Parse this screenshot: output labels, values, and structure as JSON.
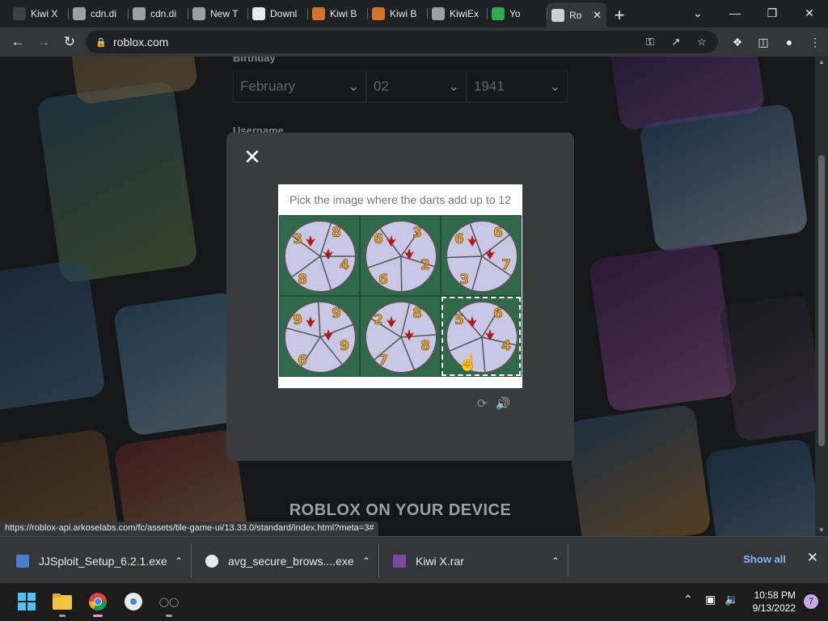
{
  "tabs": [
    {
      "label": "Kiwi X",
      "favicon": "kiwi-icon",
      "color": "#3c4043"
    },
    {
      "label": "cdn.di",
      "favicon": "globe-icon",
      "color": "#9aa0a6"
    },
    {
      "label": "cdn.di",
      "favicon": "globe-icon",
      "color": "#9aa0a6"
    },
    {
      "label": "New T",
      "favicon": "chrome-icon",
      "color": "#9aa0a6"
    },
    {
      "label": "Downl",
      "favicon": "download-icon",
      "color": "#e8eaed"
    },
    {
      "label": "Kiwi B",
      "favicon": "kiwi-icon",
      "color": "#d6722b"
    },
    {
      "label": "Kiwi B",
      "favicon": "kiwi-icon",
      "color": "#d6722b"
    },
    {
      "label": "KiwiEx",
      "favicon": "globe-icon",
      "color": "#9aa0a6"
    },
    {
      "label": "Yo",
      "favicon": "check-icon",
      "color": "#34a853"
    },
    {
      "label": "Ro",
      "favicon": "roblox-icon",
      "color": "#cfcfcf"
    }
  ],
  "address": {
    "url": "roblox.com"
  },
  "form": {
    "birthday_label": "Birthday",
    "month": "February",
    "day": "02",
    "year": "1941",
    "username_label": "Username"
  },
  "captcha": {
    "prompt": "Pick the image where the darts add up to 12",
    "tiles": [
      {
        "numbers": [
          "3",
          "8",
          "4",
          "8"
        ]
      },
      {
        "numbers": [
          "6",
          "3",
          "2",
          "6"
        ]
      },
      {
        "numbers": [
          "6",
          "6",
          "7",
          "3"
        ]
      },
      {
        "numbers": [
          "9",
          "9",
          "9",
          "6"
        ]
      },
      {
        "numbers": [
          "2",
          "8",
          "8",
          "7"
        ]
      },
      {
        "numbers": [
          "5",
          "6",
          "4"
        ]
      }
    ],
    "selected_tile": 5
  },
  "promo_heading": "ROBLOX ON YOUR DEVICE",
  "status_url": "https://roblox-api.arkoselabs.com/fc/assets/tile-game-ui/13.33.0/standard/index.html?meta=3#",
  "downloads": {
    "items": [
      {
        "name": "JJSploit_Setup_6.2.1.exe",
        "icon": "exe-icon"
      },
      {
        "name": "avg_secure_brows....exe",
        "icon": "avg-icon"
      },
      {
        "name": "Kiwi X.rar",
        "icon": "rar-icon"
      }
    ],
    "show_all": "Show all"
  },
  "taskbar": {
    "time": "10:58 PM",
    "date": "9/13/2022",
    "notification_count": "7"
  }
}
